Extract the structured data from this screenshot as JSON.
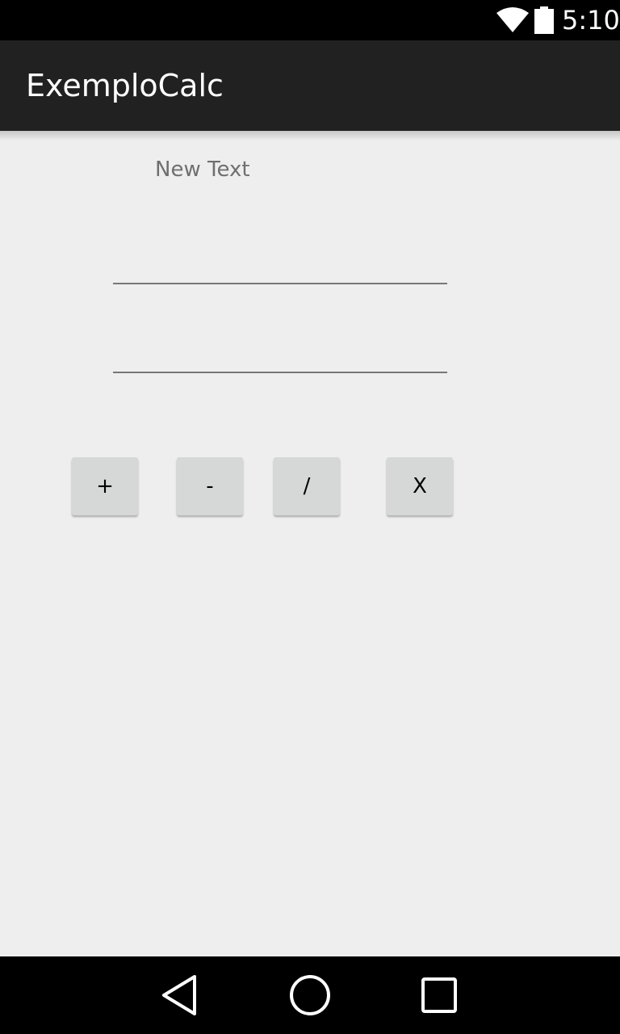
{
  "status_bar": {
    "time": "5:10",
    "icons": [
      "wifi-icon",
      "battery-icon"
    ]
  },
  "action_bar": {
    "title": "ExemploCalc"
  },
  "main": {
    "label": "New Text",
    "input1": {
      "value": "",
      "placeholder": ""
    },
    "input2": {
      "value": "",
      "placeholder": ""
    },
    "buttons": {
      "add": "+",
      "subtract": "-",
      "divide": "/",
      "multiply": "X"
    }
  },
  "nav_bar": {
    "icons": [
      "back-icon",
      "home-icon",
      "recent-apps-icon"
    ]
  },
  "colors": {
    "status_bar": "#000000",
    "action_bar": "#212121",
    "background": "#eeeeee",
    "button": "#d6d7d7"
  }
}
